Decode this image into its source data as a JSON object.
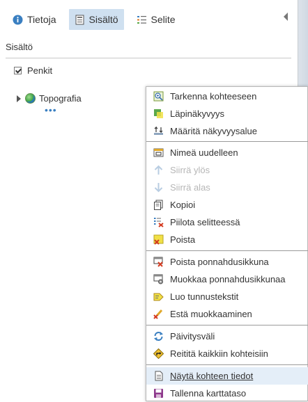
{
  "tabs": [
    {
      "label": "Tietoja",
      "icon": "info-icon",
      "active": false
    },
    {
      "label": "Sisältö",
      "icon": "content-icon",
      "active": true
    },
    {
      "label": "Selite",
      "icon": "legend-icon",
      "active": false
    }
  ],
  "section": {
    "title": "Sisältö"
  },
  "layers": {
    "penkit": {
      "label": "Penkit",
      "checked": true
    },
    "topografia": {
      "label": "Topografia"
    },
    "more": "•••"
  },
  "menu": {
    "zoom_to": "Tarkenna kohteeseen",
    "transparency": "Läpinäkyvyys",
    "visibility_range": "Määritä näkyvyysalue",
    "rename": "Nimeä uudelleen",
    "move_up": "Siirrä ylös",
    "move_down": "Siirrä alas",
    "copy": "Kopioi",
    "hide_in_legend": "Piilota selitteessä",
    "remove": "Poista",
    "remove_popup": "Poista ponnahdusikkuna",
    "configure_popup": "Muokkaa ponnahdusikkunaa",
    "create_labels": "Luo tunnustekstit",
    "disable_editing": "Estä muokkaaminen",
    "refresh_interval": "Päivitysväli",
    "route_to_all": "Reititä kaikkiin kohteisiin",
    "show_item_details": "Näytä kohteen tiedot",
    "save_layer": "Tallenna karttataso"
  },
  "colors": {
    "accent": "#3a7fc1",
    "active_tab": "#cfe0f0",
    "hover": "#e4eef8"
  }
}
